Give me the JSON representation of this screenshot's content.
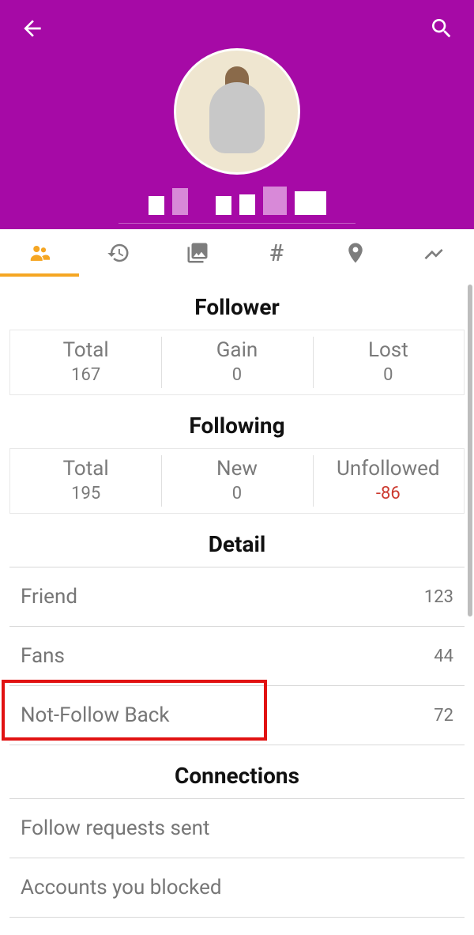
{
  "header": {
    "username_redacted": true
  },
  "tabs": [
    {
      "name": "people",
      "active": true
    },
    {
      "name": "history",
      "active": false
    },
    {
      "name": "media",
      "active": false
    },
    {
      "name": "hashtag",
      "active": false
    },
    {
      "name": "location",
      "active": false
    },
    {
      "name": "trends",
      "active": false
    }
  ],
  "sections": {
    "follower": {
      "title": "Follower",
      "cells": [
        {
          "label": "Total",
          "value": "167"
        },
        {
          "label": "Gain",
          "value": "0"
        },
        {
          "label": "Lost",
          "value": "0"
        }
      ]
    },
    "following": {
      "title": "Following",
      "cells": [
        {
          "label": "Total",
          "value": "195"
        },
        {
          "label": "New",
          "value": "0"
        },
        {
          "label": "Unfollowed",
          "value": "-86",
          "negative": true
        }
      ]
    },
    "detail": {
      "title": "Detail",
      "rows": [
        {
          "label": "Friend",
          "value": "123"
        },
        {
          "label": "Fans",
          "value": "44"
        },
        {
          "label": "Not-Follow Back",
          "value": "72",
          "highlight": true
        }
      ]
    },
    "connections": {
      "title": "Connections",
      "rows": [
        {
          "label": "Follow requests sent",
          "value": ""
        },
        {
          "label": "Accounts you blocked",
          "value": ""
        }
      ]
    }
  }
}
